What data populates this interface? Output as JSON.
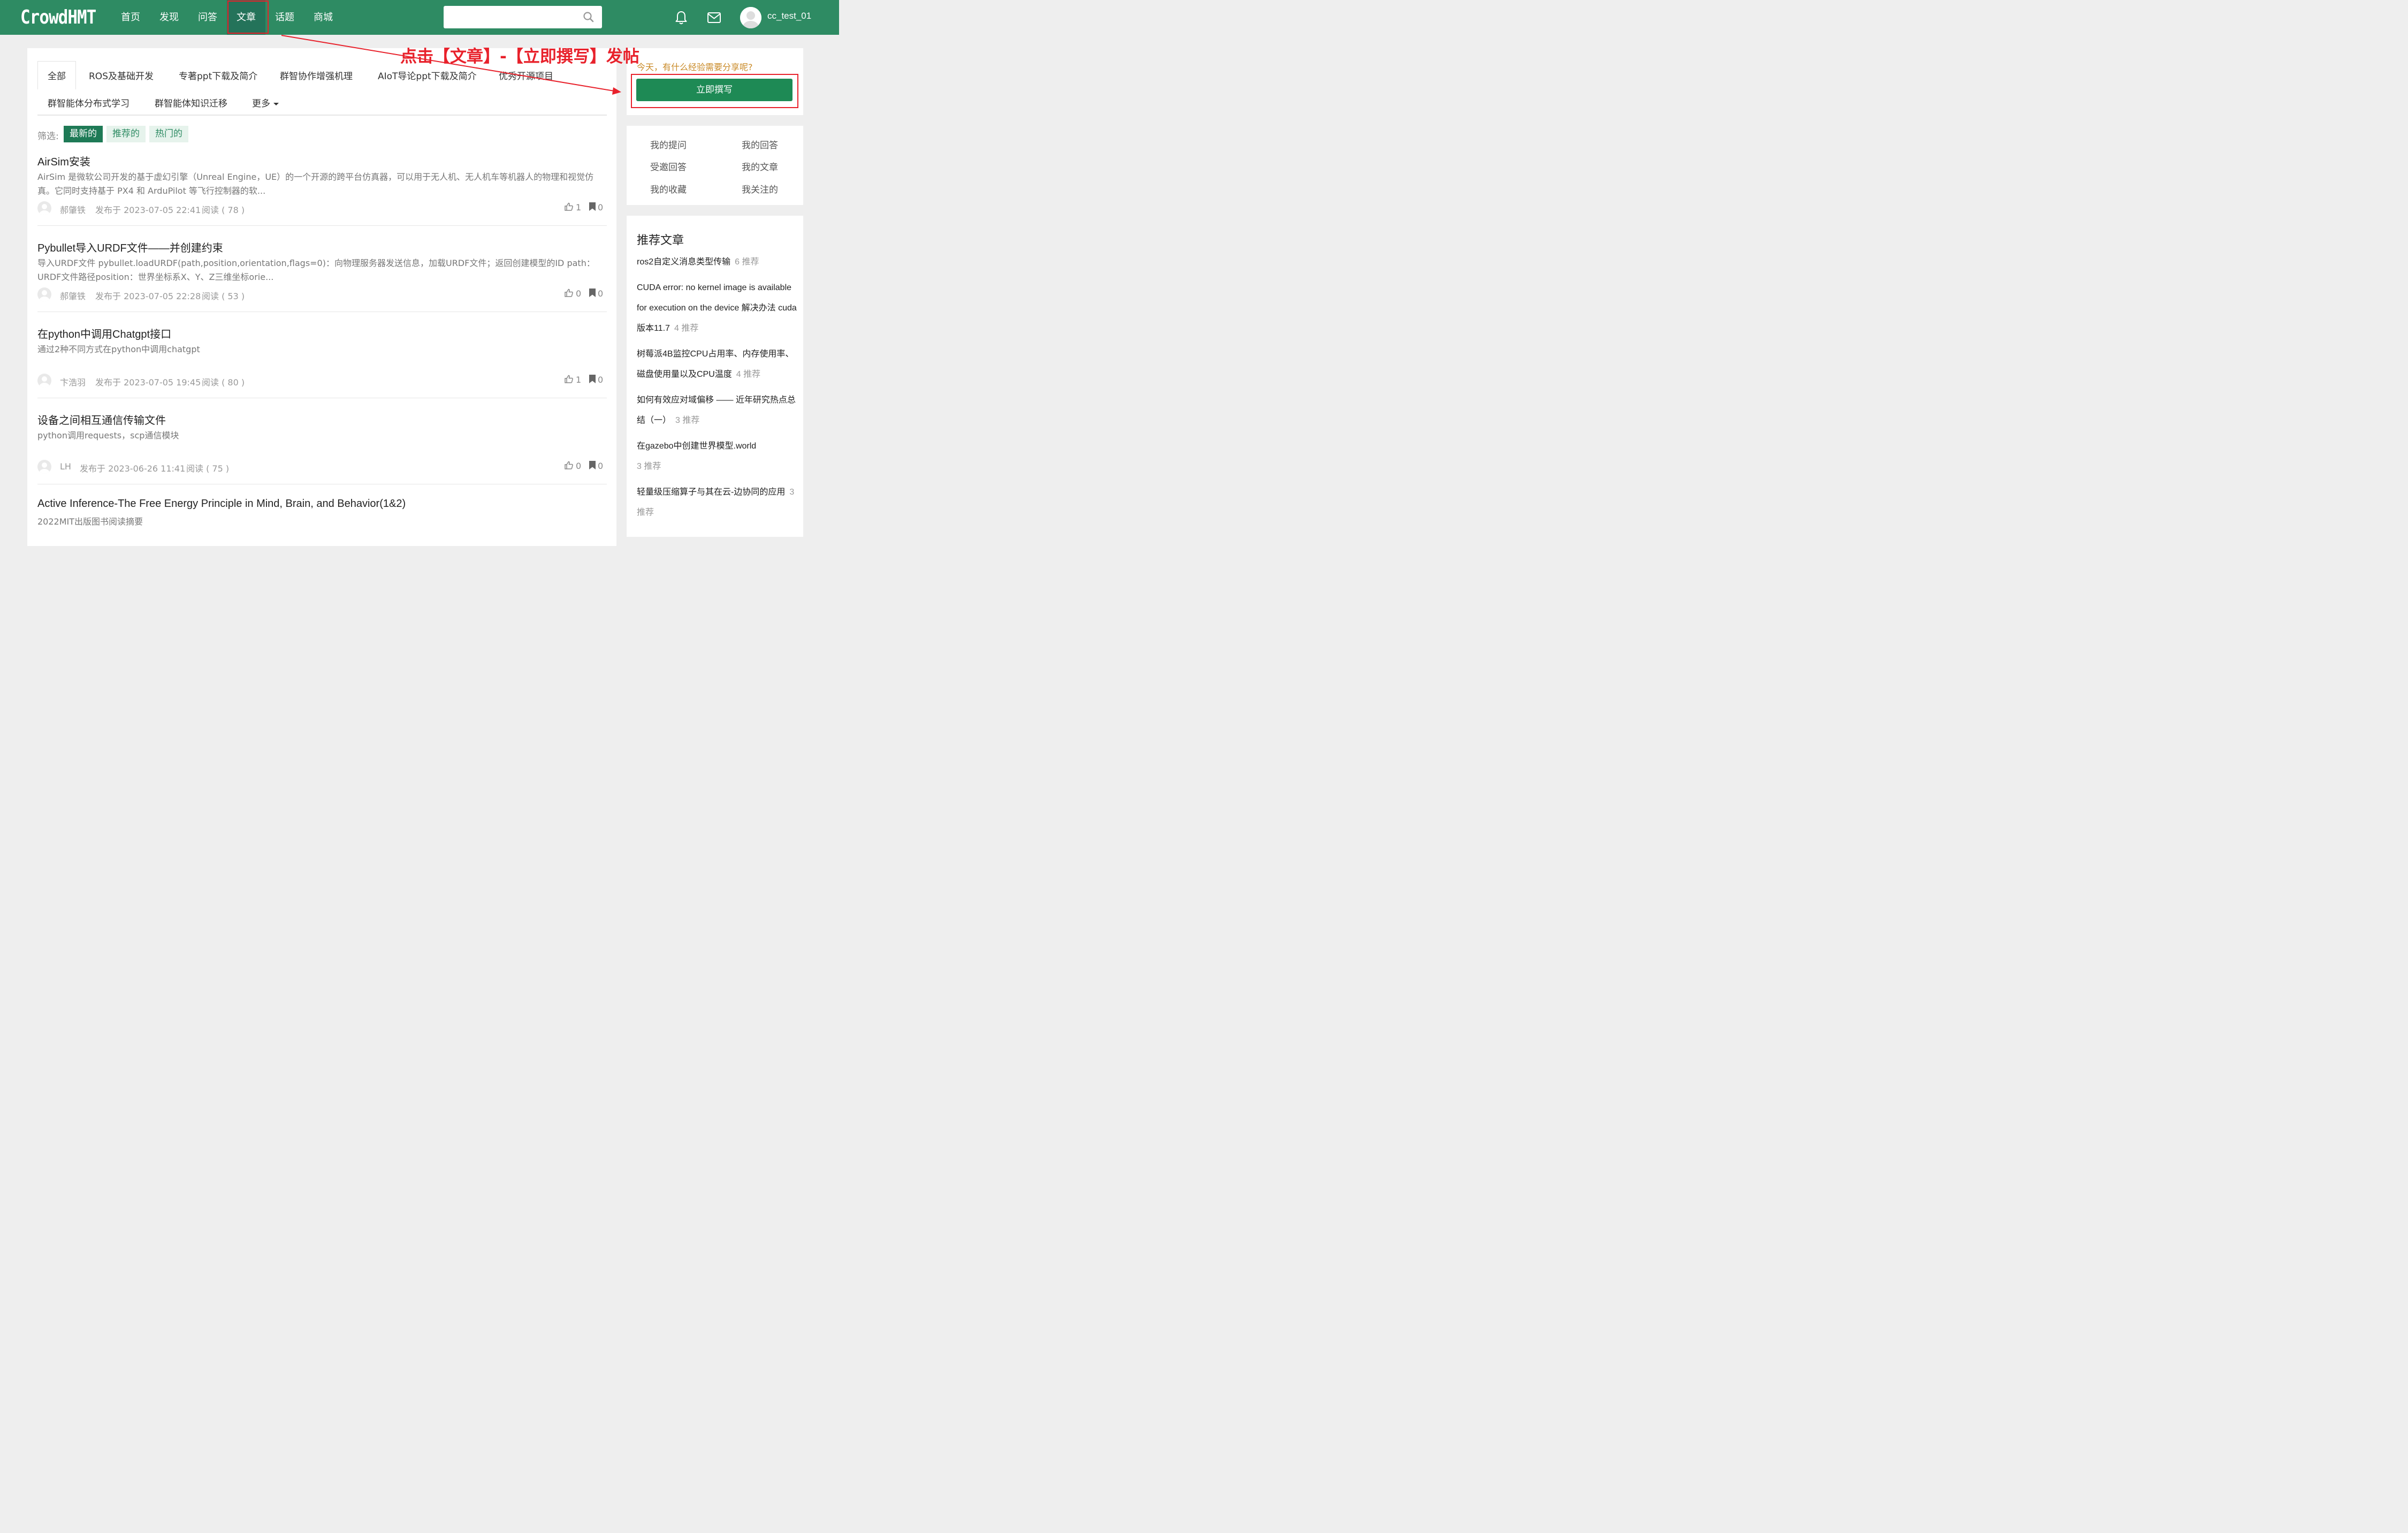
{
  "header": {
    "logo": "CrowdHMT",
    "nav": [
      "首页",
      "发现",
      "问答",
      "文章",
      "话题",
      "商城"
    ],
    "active_nav": "文章",
    "search_placeholder": "",
    "username": "cc_test_01"
  },
  "annotation": {
    "text": "点击【文章】-【立即撰写】发帖",
    "color": "#e8212b"
  },
  "tabs": {
    "row1": [
      "全部",
      "ROS及基础开发",
      "专著ppt下载及简介",
      "群智协作增强机理",
      "AIoT导论ppt下载及简介",
      "优秀开源项目"
    ],
    "row2": [
      "群智能体分布式学习",
      "群智能体知识迁移"
    ],
    "more": "更多"
  },
  "filter": {
    "label": "筛选:",
    "options": [
      "最新的",
      "推荐的",
      "热门的"
    ],
    "selected": "最新的"
  },
  "articles": [
    {
      "title": "AirSim安装",
      "summary": "AirSim 是微软公司开发的基于虚幻引擎（Unreal Engine，UE）的一个开源的跨平台仿真器，可以用于无人机、无人机车等机器人的物理和视觉仿真。它同时支持基于 PX4 和 ArduPilot 等飞行控制器的软...",
      "author": "郝肇铁",
      "posted": "发布于 2023-07-05 22:41",
      "reads": "阅读 ( 78 )",
      "likes": "1",
      "bookmarks": "0"
    },
    {
      "title": "Pybullet导入URDF文件——并创建约束",
      "summary": "导入URDF文件 pybullet.loadURDF(path,position,orientation,flags=0)：向物理服务器发送信息，加载URDF文件；返回创建模型的ID path：URDF文件路径position：世界坐标系X、Y、Z三维坐标orie...",
      "author": "郝肇铁",
      "posted": "发布于 2023-07-05 22:28",
      "reads": "阅读 ( 53 )",
      "likes": "0",
      "bookmarks": "0"
    },
    {
      "title": "在python中调用Chatgpt接口",
      "summary": "通过2种不同方式在python中调用chatgpt",
      "author": "卞浩羽",
      "posted": "发布于 2023-07-05 19:45",
      "reads": "阅读 ( 80 )",
      "likes": "1",
      "bookmarks": "0"
    },
    {
      "title": "设备之间相互通信传输文件",
      "summary": "python调用requests，scp通信模块",
      "author": "LH",
      "posted": "发布于 2023-06-26 11:41",
      "reads": "阅读 ( 75 )",
      "likes": "0",
      "bookmarks": "0"
    },
    {
      "title": "Active Inference-The Free Energy Principle in Mind, Brain, and Behavior(1&2)",
      "summary": "2022MIT出版图书阅读摘要"
    }
  ],
  "sidebar": {
    "share_prompt": "今天，有什么经验需要分享呢?",
    "write_button": "立即撰写",
    "quick_links": [
      "我的提问",
      "我的回答",
      "受邀回答",
      "我的文章",
      "我的收藏",
      "我关注的"
    ],
    "recommended_title": "推荐文章",
    "recommended": [
      {
        "title": "ros2自定义消息类型传输",
        "count": "6 推荐"
      },
      {
        "title": "CUDA error: no kernel image is available for execution on the device 解决办法 cuda版本11.7",
        "count": "4 推荐"
      },
      {
        "title": "树莓派4B监控CPU占用率、内存使用率、磁盘使用量以及CPU温度",
        "count": "4 推荐"
      },
      {
        "title": "如何有效应对域偏移 —— 近年研究热点总结（一）",
        "count": "3 推荐"
      },
      {
        "title": "在gazebo中创建世界模型.world",
        "count": "3 推荐"
      },
      {
        "title": "轻量级压缩算子与其在云-边协同的应用",
        "count": "3 推荐"
      }
    ]
  }
}
